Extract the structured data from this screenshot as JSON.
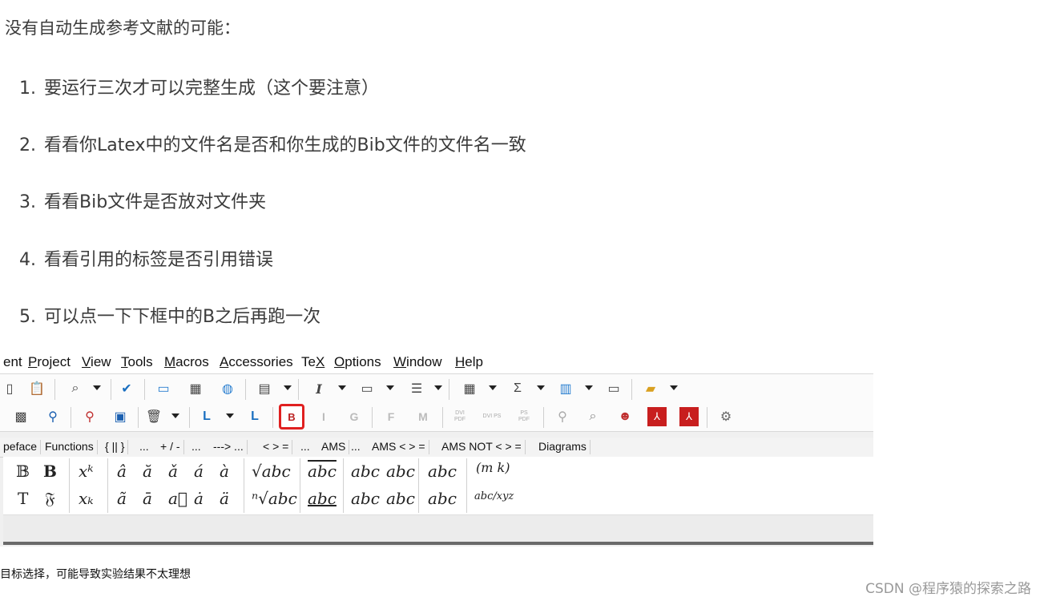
{
  "article": {
    "intro": "没有自动生成参考文献的可能：",
    "items": [
      {
        "num": "1.",
        "text": "要运行三次才可以完整生成（这个要注意）"
      },
      {
        "num": "2.",
        "text": "看看你Latex中的文件名是否和你生成的Bib文件的文件名一致"
      },
      {
        "num": "3.",
        "text": "看看Bib文件是否放对文件夹"
      },
      {
        "num": "4.",
        "text": "看看引用的标签是否引用错误"
      },
      {
        "num": "5.",
        "text": "可以点一下下框中的B之后再跑一次"
      }
    ]
  },
  "screenshot": {
    "menu": [
      {
        "label": "ent"
      },
      {
        "label": "Project",
        "u": "P"
      },
      {
        "label": "View",
        "u": "V"
      },
      {
        "label": "Tools",
        "u": "T"
      },
      {
        "label": "Macros",
        "u": "M"
      },
      {
        "label": "Accessories",
        "u": "A"
      },
      {
        "label": "TeX",
        "u": "X"
      },
      {
        "label": "Options",
        "u": "O"
      },
      {
        "label": "Window",
        "u": "W"
      },
      {
        "label": "Help",
        "u": "H"
      }
    ],
    "toolbar2": {
      "bibtex_label": "B",
      "italic_label": "I",
      "g_label": "G",
      "f_label": "F",
      "m_label": "M",
      "dvi_pdf": "DVI PDF",
      "dvi_ps": "DVI PS",
      "ps_pdf": "PS PDF"
    },
    "tabs": [
      "peface",
      "Functions",
      "{ || }",
      "...",
      "+ / -",
      "...",
      "---> ...",
      "< > =",
      "...",
      "AMS",
      "...",
      "AMS < > =",
      "AMS NOT < > =",
      "Diagrams"
    ],
    "symbols": {
      "row1": [
        "𝔹",
        "B",
        "xᵏ",
        "â",
        "ă",
        "ǎ",
        "á",
        "à",
        "√abc",
        "abc",
        "abc",
        "abc",
        "abc",
        "(m k)"
      ],
      "row2": [
        "T",
        "𝔉",
        "xₖ",
        "ã",
        "ā",
        "a⃗",
        "ȧ",
        "ä",
        "ⁿ√abc",
        "abc",
        "abc",
        "abc",
        "abc",
        "abc/xyz"
      ]
    },
    "caption": "目标选择，可能导致实验结果不太理想"
  },
  "watermark": "CSDN @程序猿的探索之路",
  "colors": {
    "highlight": "#e02020",
    "text": "#3b3b3b"
  }
}
